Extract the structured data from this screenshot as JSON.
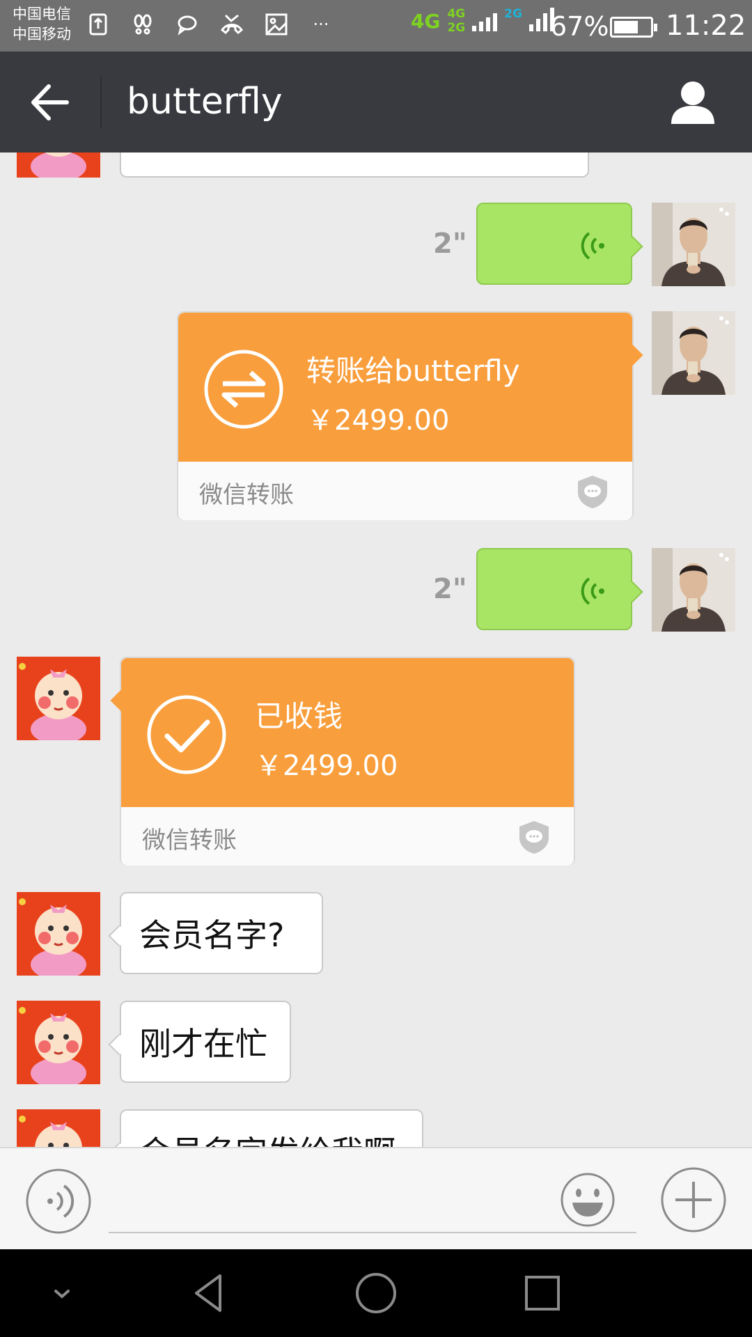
{
  "status_bar": {
    "carrier_1": "中国电信",
    "carrier_2": "中国移动",
    "more": "···",
    "net_4g": "4G",
    "net_4g_small": "4G",
    "net_2g_small": "2G",
    "net_2g": "2G",
    "battery_percent": "67%",
    "battery_level": 0.67,
    "time": "11:22"
  },
  "header": {
    "title": "butterfly",
    "back_icon": "arrow-left-icon",
    "profile_icon": "person-icon"
  },
  "messages": [
    {
      "id": 1,
      "sender": "me",
      "type": "voice",
      "duration": "2\""
    },
    {
      "id": 2,
      "sender": "me",
      "type": "transfer",
      "label": "转账给butterfly",
      "amount": "￥2499.00",
      "footer": "微信转账"
    },
    {
      "id": 3,
      "sender": "me",
      "type": "voice",
      "duration": "2\""
    },
    {
      "id": 4,
      "sender": "butterfly",
      "type": "transfer",
      "label": "已收钱",
      "amount": "￥2499.00",
      "footer": "微信转账"
    },
    {
      "id": 5,
      "sender": "butterfly",
      "type": "text",
      "text": "会员名字?"
    },
    {
      "id": 6,
      "sender": "butterfly",
      "type": "text",
      "text": "刚才在忙"
    },
    {
      "id": 7,
      "sender": "butterfly",
      "type": "text",
      "text": "会员名字发给我啊"
    }
  ],
  "input_bar": {
    "voice_icon": "voice-input-icon",
    "text_value": "",
    "emoji_icon": "emoji-icon",
    "more_icon": "plus-icon"
  },
  "nav_bar": {
    "icons": [
      "chevron-down-icon",
      "back-triangle-icon",
      "home-circle-icon",
      "recents-square-icon"
    ]
  },
  "colors": {
    "header_bg": "#393a3f",
    "transfer_orange": "#f99e3c",
    "voice_green": "#a9e565",
    "chat_bg": "#ebebeb"
  }
}
